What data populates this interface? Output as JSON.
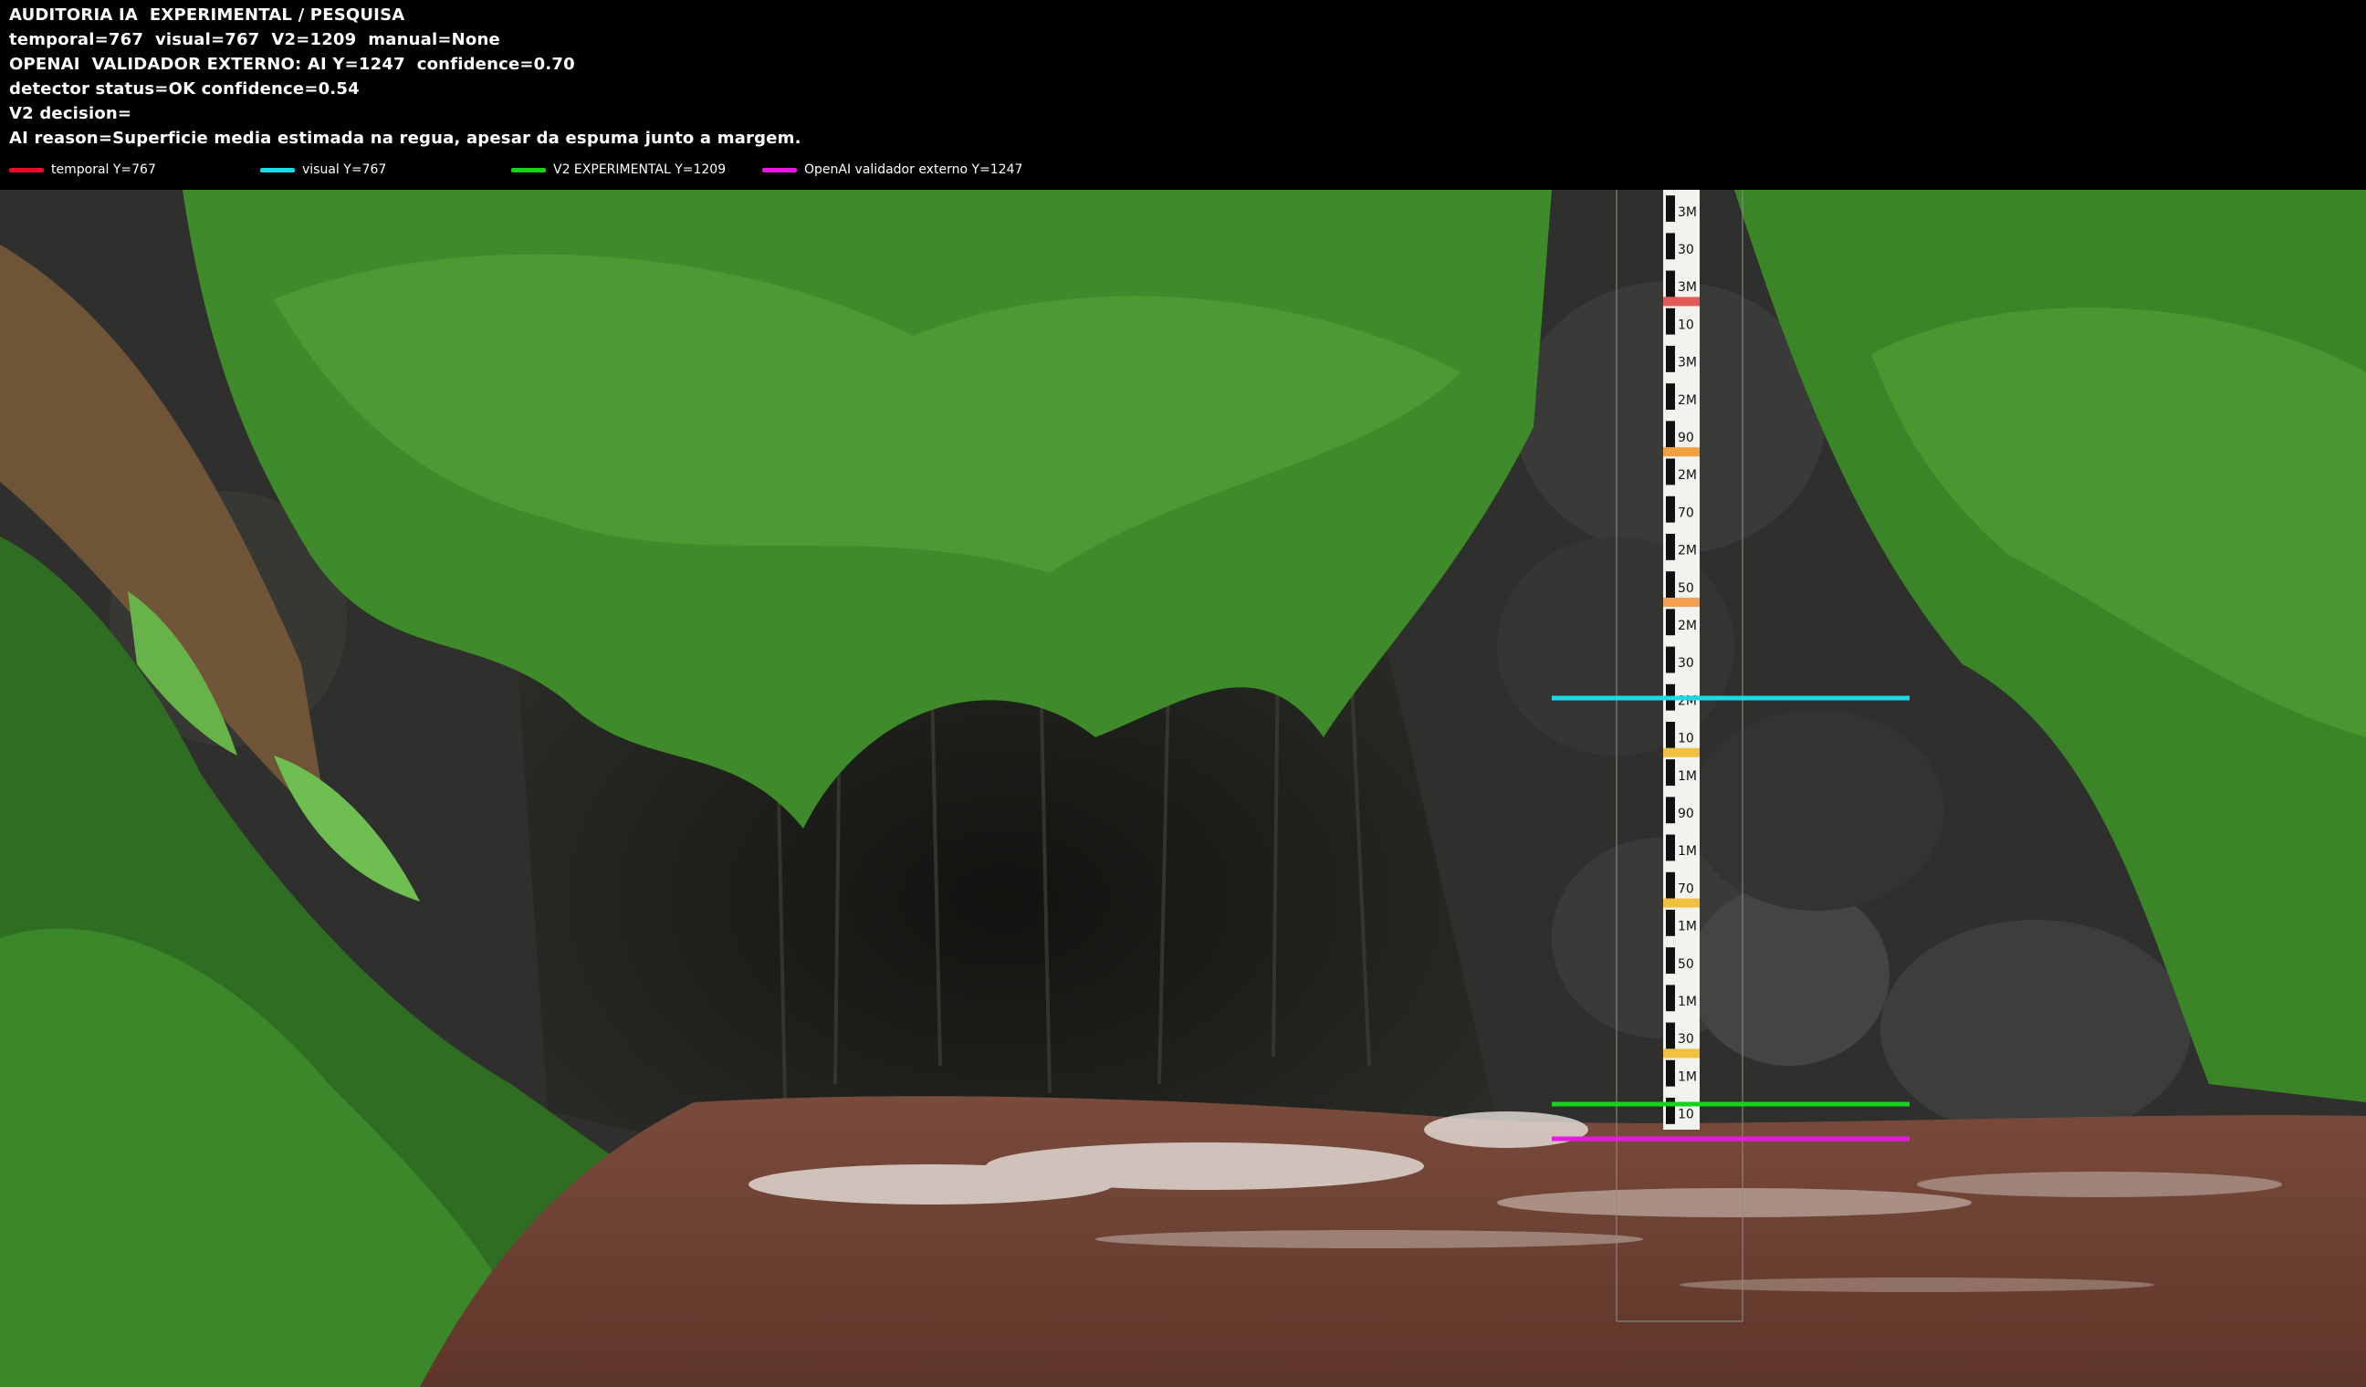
{
  "header": {
    "lines": [
      "AUDITORIA IA  EXPERIMENTAL / PESQUISA",
      "temporal=767  visual=767  V2=1209  manual=None",
      "OPENAI  VALIDADOR EXTERNO: AI Y=1247  confidence=0.70",
      "detector status=OK confidence=0.54",
      "V2 decision=",
      "AI reason=Superficie media estimada na regua, apesar da espuma junto a margem."
    ]
  },
  "legend": [
    {
      "label": "temporal Y=767",
      "color": "#e0102a"
    },
    {
      "label": "visual Y=767",
      "color": "#22d6e6"
    },
    {
      "label": "V2 EXPERIMENTAL Y=1209",
      "color": "#19d21c"
    },
    {
      "label": "OpenAI validador externo Y=1247",
      "color": "#e619e0"
    }
  ],
  "gauge": {
    "labels": [
      "3M",
      "30",
      "3M",
      "10",
      "3M",
      "2M",
      "90",
      "2M",
      "70",
      "2M",
      "50",
      "2M",
      "30",
      "2M",
      "10",
      "1M",
      "90",
      "1M",
      "70",
      "1M",
      "50",
      "1M",
      "30",
      "1M",
      "10"
    ]
  },
  "colors": {
    "water": "#6e4234",
    "foliage": "#3f8a2a",
    "rock": "#2f302e",
    "cave": "#1a1c18"
  }
}
